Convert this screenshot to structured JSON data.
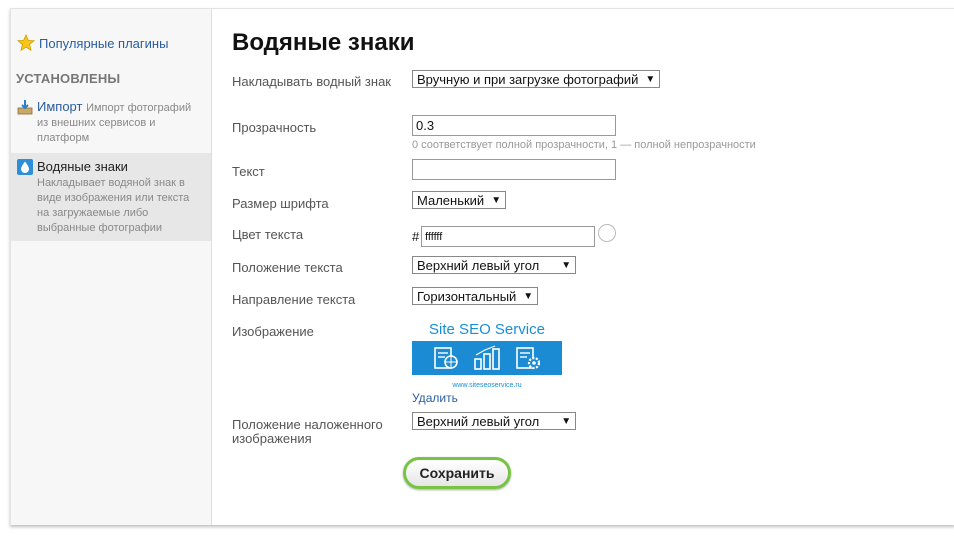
{
  "sidebar": {
    "popular": "Популярные плагины",
    "section_heading": "УСТАНОВЛЕНЫ",
    "import": {
      "title": "Импорт",
      "desc_inline": "Импорт фотографий",
      "desc_rest": "из внешних сервисов и платформ"
    },
    "watermarks": {
      "title": "Водяные знаки",
      "desc": "Накладывает водяной знак в виде изображения или текста на загружаемые либо выбранные фотографии"
    }
  },
  "main": {
    "title": "Водяные знаки",
    "apply": {
      "label": "Накладывать водный знак",
      "value": "Вручную и при загрузке фотографий"
    },
    "opacity": {
      "label": "Прозрачность",
      "value": "0.3",
      "hint": "0 соответствует полной прозрачности, 1 — полной непрозрачности"
    },
    "text": {
      "label": "Текст",
      "value": ""
    },
    "font_size": {
      "label": "Размер шрифта",
      "value": "Маленький"
    },
    "text_color": {
      "label": "Цвет текста",
      "hash": "#",
      "value": "ffffff"
    },
    "text_position": {
      "label": "Положение текста",
      "value": "Верхний левый угол"
    },
    "text_direction": {
      "label": "Направление текста",
      "value": "Горизонтальный"
    },
    "image": {
      "label": "Изображение",
      "watermark_title": "Site SEO Service",
      "watermark_url": "www.siteseoservice.ru",
      "delete_link": "Удалить"
    },
    "image_position": {
      "label": "Положение наложенного изображения",
      "value": "Верхний левый угол"
    },
    "save_button": "Сохранить"
  },
  "colors": {
    "link": "#2a5d9f",
    "accent_green": "#76c442",
    "watermark_blue": "#1b8bd3"
  }
}
